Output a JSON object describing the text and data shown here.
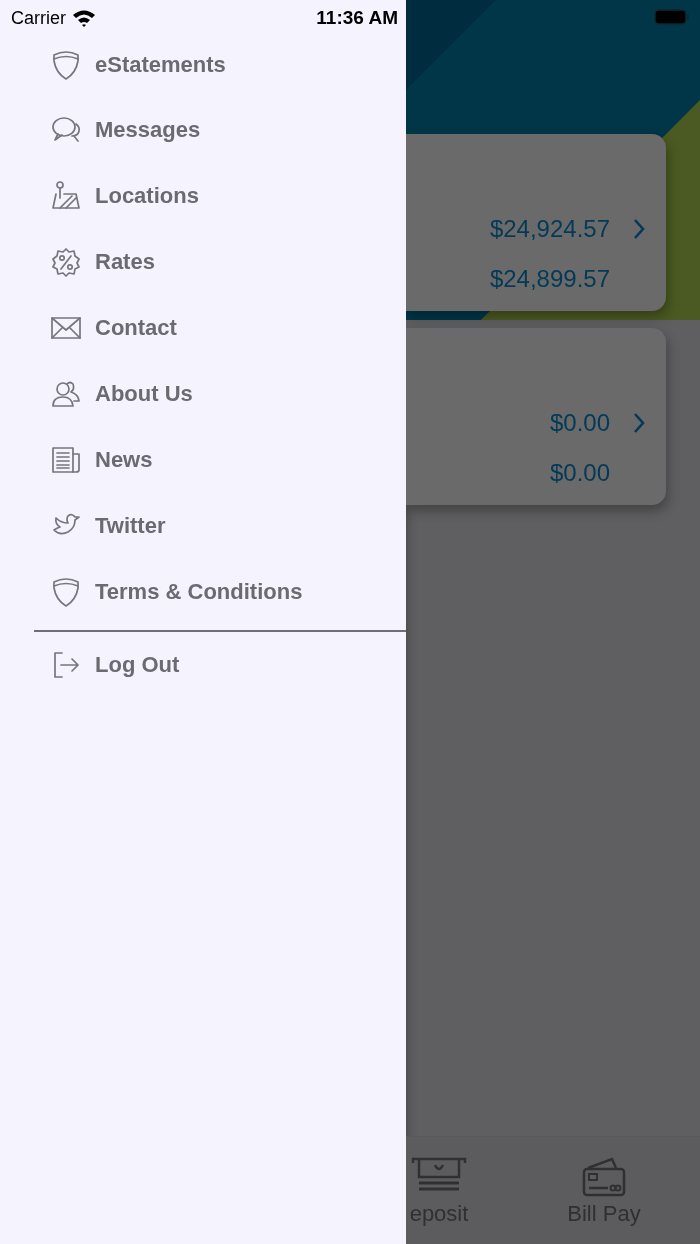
{
  "status_bar": {
    "carrier": "Carrier",
    "time": "11:36 AM"
  },
  "menu": {
    "items": [
      {
        "label": "eStatements"
      },
      {
        "label": "Messages"
      },
      {
        "label": "Locations"
      },
      {
        "label": "Rates"
      },
      {
        "label": "Contact"
      },
      {
        "label": "About Us"
      },
      {
        "label": "News"
      },
      {
        "label": "Twitter"
      },
      {
        "label": "Terms & Conditions"
      }
    ],
    "logout": {
      "label": "Log Out"
    }
  },
  "accounts": [
    {
      "balance": "$24,924.57",
      "available": "$24,899.57"
    },
    {
      "balance": "$0.00",
      "available": "$0.00"
    }
  ],
  "tab_bar": [
    {
      "label": "eposit"
    },
    {
      "label": "Bill Pay"
    }
  ]
}
